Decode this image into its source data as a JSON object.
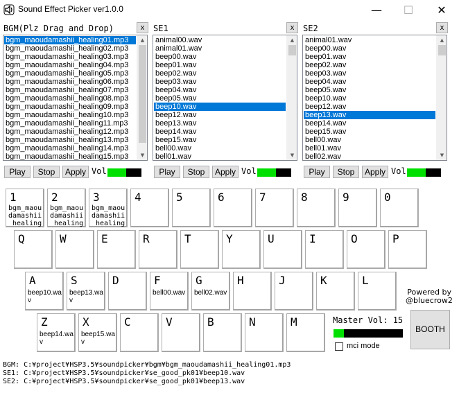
{
  "window": {
    "title": "Sound Effect Picker ver1.0.0",
    "min": "—",
    "max": "☐",
    "close": "✕"
  },
  "panels": [
    {
      "label": "BGM(Plz Drag and Drop)",
      "close": "x",
      "items": [
        "bgm_maoudamashii_healing01.mp3",
        "bgm_maoudamashii_healing02.mp3",
        "bgm_maoudamashii_healing03.mp3",
        "bgm_maoudamashii_healing04.mp3",
        "bgm_maoudamashii_healing05.mp3",
        "bgm_maoudamashii_healing06.mp3",
        "bgm_maoudamashii_healing07.mp3",
        "bgm_maoudamashii_healing08.mp3",
        "bgm_maoudamashii_healing09.mp3",
        "bgm_maoudamashii_healing10.mp3",
        "bgm_maoudamashii_healing11.mp3",
        "bgm_maoudamashii_healing12.mp3",
        "bgm_maoudamashii_healing13.mp3",
        "bgm_maoudamashii_healing14.mp3",
        "bgm_maoudamashii_healing15.mp3"
      ],
      "selected": 0,
      "scroll_thumb": 0.93,
      "play": "Play",
      "stop": "Stop",
      "apply": "Apply",
      "vol_label": "Vol",
      "volume": 0.55
    },
    {
      "label": "SE1",
      "close": "x",
      "items": [
        "animal00.wav",
        "animal01.wav",
        "beep00.wav",
        "beep01.wav",
        "beep02.wav",
        "beep03.wav",
        "beep04.wav",
        "beep05.wav",
        "beep10.wav",
        "beep12.wav",
        "beep13.wav",
        "beep14.wav",
        "beep15.wav",
        "bell00.wav",
        "bell01.wav"
      ],
      "selected": 8,
      "scroll_thumb": 0.1,
      "play": "Play",
      "stop": "Stop",
      "apply": "Apply",
      "vol_label": "Vol",
      "volume": 0.55
    },
    {
      "label": "SE2",
      "close": "x",
      "items": [
        "animal01.wav",
        "beep00.wav",
        "beep01.wav",
        "beep02.wav",
        "beep03.wav",
        "beep04.wav",
        "beep05.wav",
        "beep10.wav",
        "beep12.wav",
        "beep13.wav",
        "beep14.wav",
        "beep15.wav",
        "bell00.wav",
        "bell01.wav",
        "bell02.wav"
      ],
      "selected": 9,
      "scroll_thumb": 0.1,
      "play": "Play",
      "stop": "Stop",
      "apply": "Apply",
      "vol_label": "Vol",
      "volume": 0.55
    }
  ],
  "keys": {
    "row1": [
      {
        "key": "1",
        "sound": "bgm_maoudamashii_healing"
      },
      {
        "key": "2",
        "sound": "bgm_maoudamashii_healing"
      },
      {
        "key": "3",
        "sound": "bgm_maoudamashii_healing"
      },
      {
        "key": "4",
        "sound": ""
      },
      {
        "key": "5",
        "sound": ""
      },
      {
        "key": "6",
        "sound": ""
      },
      {
        "key": "7",
        "sound": ""
      },
      {
        "key": "8",
        "sound": ""
      },
      {
        "key": "9",
        "sound": ""
      },
      {
        "key": "0",
        "sound": ""
      }
    ],
    "row2": [
      {
        "key": "Q",
        "sound": ""
      },
      {
        "key": "W",
        "sound": ""
      },
      {
        "key": "E",
        "sound": ""
      },
      {
        "key": "R",
        "sound": ""
      },
      {
        "key": "T",
        "sound": ""
      },
      {
        "key": "Y",
        "sound": ""
      },
      {
        "key": "U",
        "sound": ""
      },
      {
        "key": "I",
        "sound": ""
      },
      {
        "key": "O",
        "sound": ""
      },
      {
        "key": "P",
        "sound": ""
      }
    ],
    "row3": [
      {
        "key": "A",
        "sound": "beep10.wav"
      },
      {
        "key": "S",
        "sound": "beep13.wav"
      },
      {
        "key": "D",
        "sound": ""
      },
      {
        "key": "F",
        "sound": "bell00.wav"
      },
      {
        "key": "G",
        "sound": "bell02.wav"
      },
      {
        "key": "H",
        "sound": ""
      },
      {
        "key": "J",
        "sound": ""
      },
      {
        "key": "K",
        "sound": ""
      },
      {
        "key": "L",
        "sound": ""
      }
    ],
    "row4": [
      {
        "key": "Z",
        "sound": "beep14.wav"
      },
      {
        "key": "X",
        "sound": "beep15.wav"
      },
      {
        "key": "C",
        "sound": ""
      },
      {
        "key": "V",
        "sound": ""
      },
      {
        "key": "B",
        "sound": ""
      },
      {
        "key": "N",
        "sound": ""
      },
      {
        "key": "M",
        "sound": ""
      }
    ]
  },
  "powered_by": "Powered by\n@bluecrow2",
  "master": {
    "label": "Master Vol: 15",
    "volume": 0.15
  },
  "mci_mode": {
    "label": "mci mode",
    "checked": false
  },
  "booth": "BOOTH",
  "status": {
    "bgm": "BGM: C:¥project¥HSP3.5¥soundpicker¥bgm¥bgm_maoudamashii_healing01.mp3",
    "se1": "SE1: C:¥project¥HSP3.5¥soundpicker¥se_good_pk01¥beep10.wav",
    "se2": "SE2: C:¥project¥HSP3.5¥soundpicker¥se_good_pk01¥beep13.wav"
  },
  "colors": {
    "selection": "#0078d7",
    "volume_fill": "#00e000"
  }
}
